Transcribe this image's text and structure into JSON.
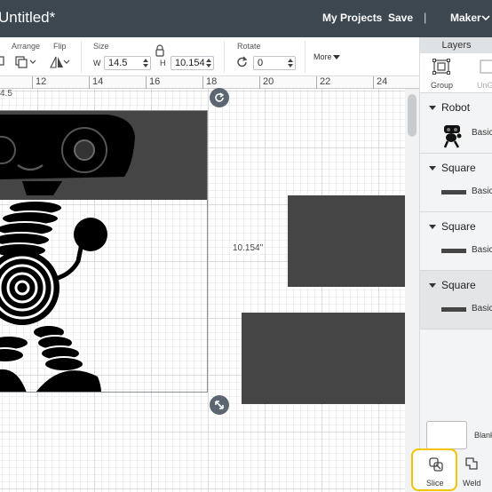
{
  "header": {
    "title": "Untitled*",
    "my_projects": "My Projects",
    "save": "Save",
    "separator": "|",
    "machine": "Maker"
  },
  "toolbar": {
    "arrange_label": "Arrange",
    "flip_label": "Flip",
    "size_label": "Size",
    "width_prefix": "W",
    "width_value": "14.5",
    "height_prefix": "H",
    "height_value": "10.154",
    "rotate_label": "Rotate",
    "rotate_value": "0",
    "more_label": "More"
  },
  "ruler": {
    "numbers": [
      "12",
      "14",
      "16",
      "18",
      "20",
      "22",
      "24"
    ],
    "left_partial": "4.5"
  },
  "canvas": {
    "height_dimension": "10.154\"",
    "shape_color": "#454545"
  },
  "layers_panel": {
    "title": "Layers",
    "group_label": "Group",
    "ungroup_label": "UnG",
    "layers": [
      {
        "name": "Robot",
        "sub": "Basic"
      },
      {
        "name": "Square",
        "sub": "Basic"
      },
      {
        "name": "Square",
        "sub": "Basic"
      },
      {
        "name": "Square",
        "sub": "Basic"
      }
    ],
    "blank_label": "Blank",
    "slice_label": "Slice",
    "weld_label": "Weld"
  },
  "colors": {
    "header_bg": "#3c4750",
    "highlight": "#f2c400"
  }
}
